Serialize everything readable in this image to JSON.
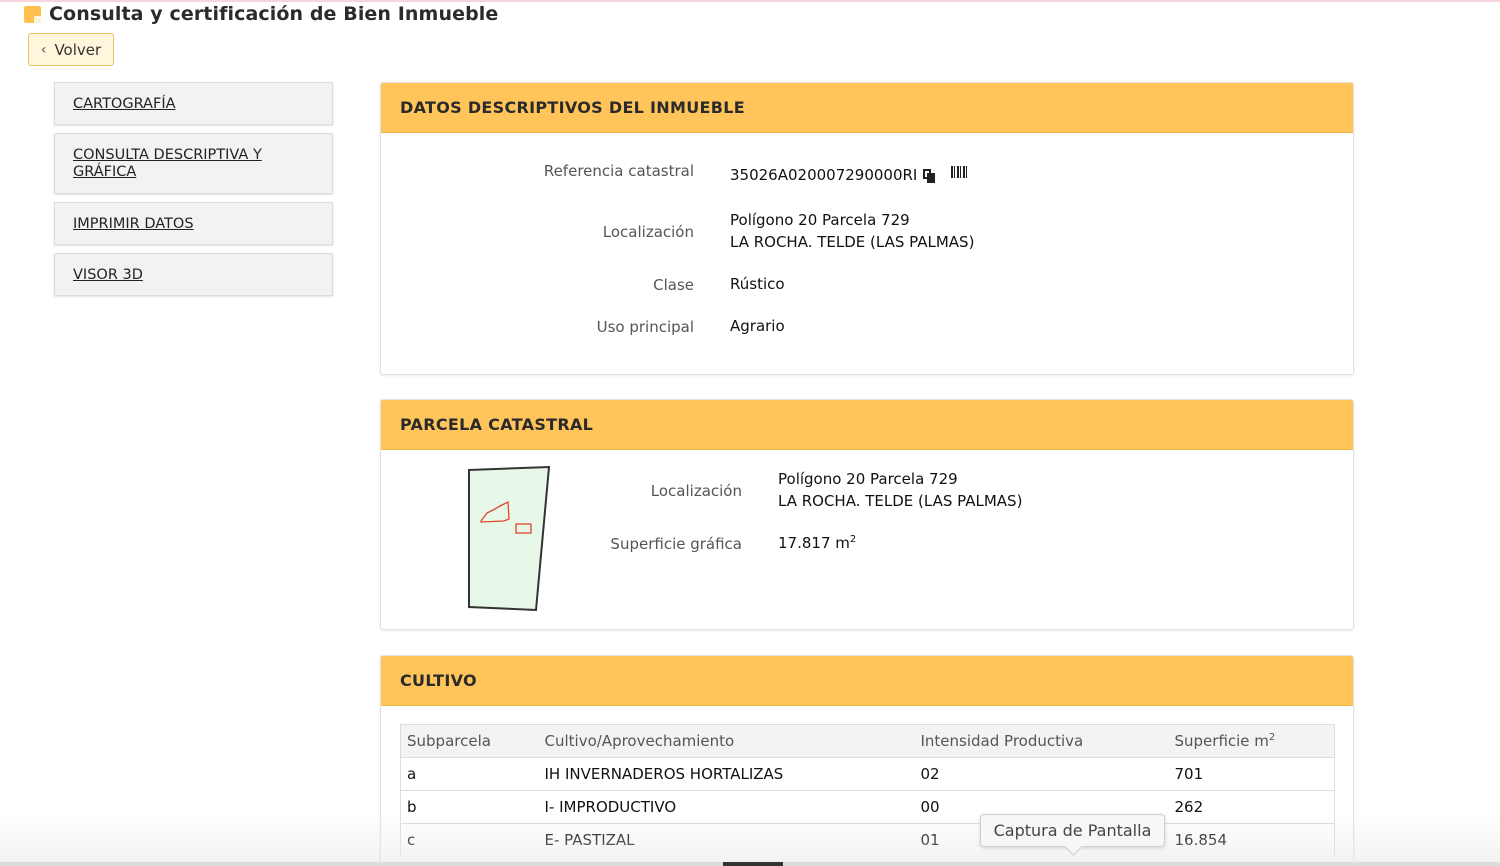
{
  "header": {
    "title": "Consulta y certificación de Bien Inmueble"
  },
  "back_button": {
    "label": "Volver"
  },
  "sidebar": {
    "items": [
      {
        "label": "CARTOGRAFÍA"
      },
      {
        "label": "CONSULTA DESCRIPTIVA Y GRÁFICA"
      },
      {
        "label": "IMPRIMIR DATOS"
      },
      {
        "label": "VISOR 3D"
      }
    ]
  },
  "datos": {
    "heading": "DATOS DESCRIPTIVOS DEL INMUEBLE",
    "ref_label": "Referencia catastral",
    "ref_value": "35026A020007290000RI",
    "loc_label": "Localización",
    "loc_line1": "Polígono 20 Parcela 729",
    "loc_line2": "LA ROCHA. TELDE (LAS PALMAS)",
    "clase_label": "Clase",
    "clase_value": "Rústico",
    "uso_label": "Uso principal",
    "uso_value": "Agrario"
  },
  "parcela": {
    "heading": "PARCELA CATASTRAL",
    "loc_label": "Localización",
    "loc_line1": "Polígono 20 Parcela 729",
    "loc_line2": "LA ROCHA. TELDE (LAS PALMAS)",
    "sup_label": "Superficie gráfica",
    "sup_value": "17.817 m",
    "sup_exp": "2",
    "colors": {
      "fill": "#e8f8e8",
      "outline": "#333333",
      "sub_outline": "#e0462e"
    }
  },
  "cultivo": {
    "heading": "CULTIVO",
    "columns": [
      "Subparcela",
      "Cultivo/Aprovechamiento",
      "Intensidad Productiva",
      "Superficie m"
    ],
    "col_exp": "2",
    "rows": [
      {
        "sub": "a",
        "cultivo": "IH INVERNADEROS HORTALIZAS",
        "intensidad": "02",
        "superficie": "701"
      },
      {
        "sub": "b",
        "cultivo": "I- IMPRODUCTIVO",
        "intensidad": "00",
        "superficie": "262"
      },
      {
        "sub": "c",
        "cultivo": "E- PASTIZAL",
        "intensidad": "01",
        "superficie": "16.854"
      }
    ]
  },
  "tooltip": {
    "text": "Captura de Pantalla"
  },
  "theme": {
    "accent": "#ffc45a",
    "back_bg": "#fff6db"
  }
}
